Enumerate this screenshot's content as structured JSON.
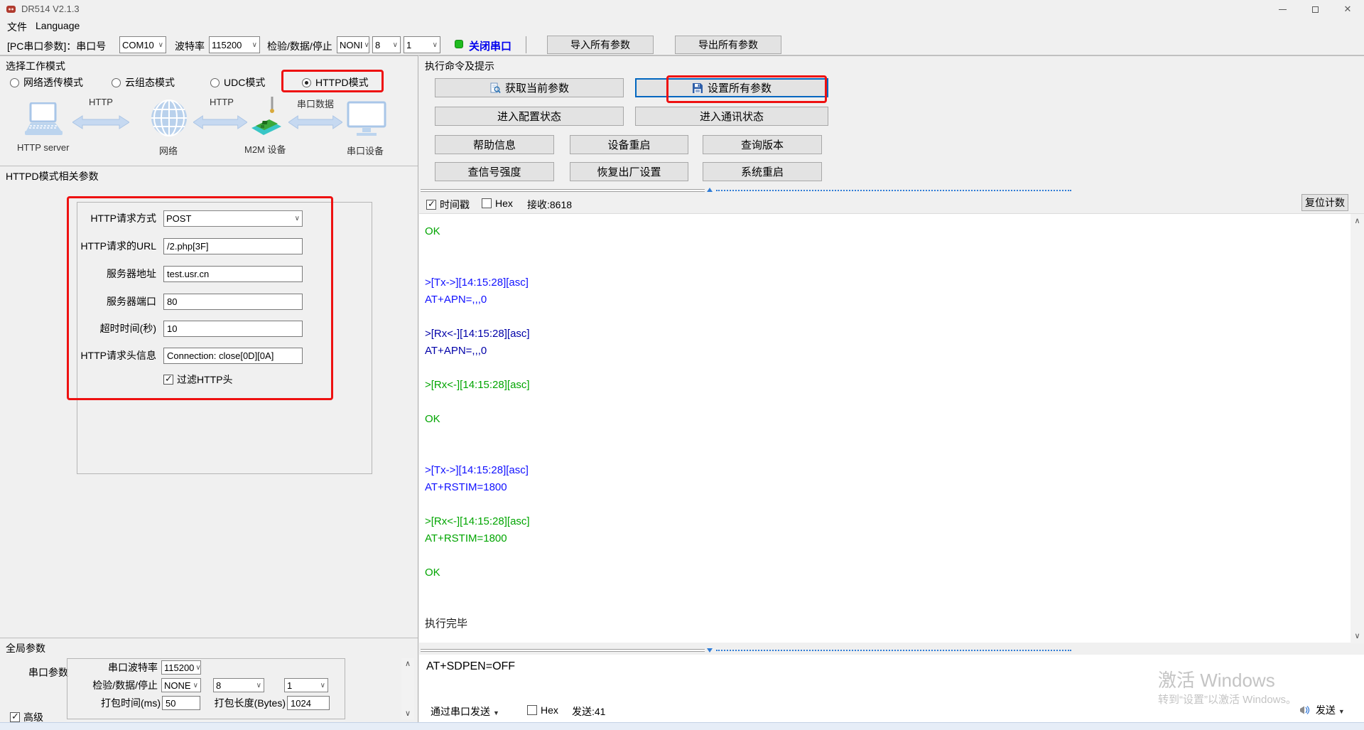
{
  "window": {
    "title": "DR514 V2.1.3"
  },
  "menu": {
    "file": "文件",
    "language": "Language"
  },
  "toolbar": {
    "pc_serial_label": "[PC串口参数]：串口号",
    "com_port": "COM10",
    "baud_label": "波特率",
    "baud_value": "115200",
    "parity_label": "检验/数据/停止",
    "parity_value": "NONI",
    "data_bits": "8",
    "stop_bits": "1",
    "close_serial_label": "关闭串口",
    "import_button": "导入所有参数",
    "export_button": "导出所有参数"
  },
  "work_mode": {
    "header": "选择工作模式",
    "options": [
      {
        "label": "网络透传模式",
        "selected": false
      },
      {
        "label": "云组态模式",
        "selected": false
      },
      {
        "label": "UDC模式",
        "selected": false
      },
      {
        "label": "HTTPD模式",
        "selected": true
      }
    ],
    "diagram": {
      "node1": "HTTP server",
      "node2": "网络",
      "node3": "M2M 设备",
      "node4": "串口设备",
      "link1": "HTTP",
      "link2": "HTTP",
      "link3": "串口数据"
    }
  },
  "httpd_params": {
    "header": "HTTPD模式相关参数",
    "fields": [
      {
        "label": "HTTP请求方式",
        "value": "POST"
      },
      {
        "label": "HTTP请求的URL",
        "value": "/2.php[3F]"
      },
      {
        "label": "服务器地址",
        "value": "test.usr.cn"
      },
      {
        "label": "服务器端口",
        "value": "80"
      },
      {
        "label": "超时时间(秒)",
        "value": "10"
      },
      {
        "label": "HTTP请求头信息",
        "value": "Connection: close[0D][0A]"
      }
    ],
    "filter_http_label": "过滤HTTP头",
    "filter_http_checked": true
  },
  "command_panel": {
    "header": "执行命令及提示",
    "get_params": "获取当前参数",
    "set_params": "设置所有参数",
    "enter_config": "进入配置状态",
    "enter_comm": "进入通讯状态",
    "help_info": "帮助信息",
    "device_restart": "设备重启",
    "query_version": "查询版本",
    "query_signal": "查信号强度",
    "factory_reset": "恢复出厂设置",
    "system_restart": "系统重启"
  },
  "log_panel": {
    "timestamp_label": "时间戳",
    "timestamp_checked": true,
    "hex_label": "Hex",
    "hex_checked": false,
    "recv_count": "接收:8618",
    "reset_count_button": "复位计数",
    "lines": [
      {
        "text": "OK",
        "color": "green"
      },
      {
        "text": "",
        "color": "green"
      },
      {
        "text": "",
        "color": "green"
      },
      {
        "text": ">[Tx->][14:15:28][asc]",
        "color": "blue"
      },
      {
        "text": "AT+APN=,,,0",
        "color": "blue"
      },
      {
        "text": "",
        "color": "blue"
      },
      {
        "text": ">[Rx<-][14:15:28][asc]",
        "color": "navy"
      },
      {
        "text": "AT+APN=,,,0",
        "color": "navy"
      },
      {
        "text": "",
        "color": "navy"
      },
      {
        "text": ">[Rx<-][14:15:28][asc]",
        "color": "green"
      },
      {
        "text": "",
        "color": "green"
      },
      {
        "text": "OK",
        "color": "green"
      },
      {
        "text": "",
        "color": "green"
      },
      {
        "text": "",
        "color": "green"
      },
      {
        "text": ">[Tx->][14:15:28][asc]",
        "color": "blue"
      },
      {
        "text": "AT+RSTIM=1800",
        "color": "blue"
      },
      {
        "text": "",
        "color": "blue"
      },
      {
        "text": ">[Rx<-][14:15:28][asc]",
        "color": "green"
      },
      {
        "text": "AT+RSTIM=1800",
        "color": "green"
      },
      {
        "text": "",
        "color": "green"
      },
      {
        "text": "OK",
        "color": "green"
      },
      {
        "text": "",
        "color": "green"
      },
      {
        "text": "",
        "color": "green"
      },
      {
        "text": "执行完毕",
        "color": "black"
      }
    ]
  },
  "send_panel": {
    "input_value": "AT+SDPEN=OFF",
    "send_via": "通过串口发送",
    "hex_label": "Hex",
    "sent_count": "发送:41",
    "send_button": "发送"
  },
  "global_params": {
    "header": "全局参数",
    "group_label": "串口参数",
    "baud_label": "串口波特率",
    "baud_value": "115200",
    "parity_label": "检验/数据/停止",
    "parity_value": "NONE",
    "data_bits": "8",
    "stop_bits": "1",
    "pack_time_label": "打包时间(ms)",
    "pack_time_value": "50",
    "pack_len_label": "打包长度(Bytes)",
    "pack_len_value": "1024",
    "advanced_label": "高级",
    "advanced_checked": true
  },
  "watermark": {
    "line1": "激活 Windows",
    "line2": "转到“设置”以激活 Windows。"
  },
  "colors": {
    "highlight_red": "#ee1111",
    "default_button_blue": "#0067c0",
    "log_green": "#00a500",
    "log_blue": "#1010ff",
    "log_navy": "#0000a8",
    "close_serial_blue": "#0000ee",
    "led_green": "#1fbb1f"
  }
}
